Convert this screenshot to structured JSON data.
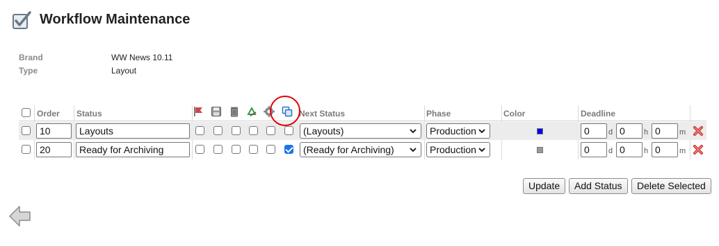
{
  "page": {
    "title": "Workflow Maintenance"
  },
  "meta": {
    "brand_label": "Brand",
    "brand_value": "WW News 10.11",
    "type_label": "Type",
    "type_value": "Layout"
  },
  "table": {
    "headers": {
      "order": "Order",
      "status": "Status",
      "next_status": "Next Status",
      "phase": "Phase",
      "color": "Color",
      "deadline": "Deadline"
    },
    "header_icons": [
      "flag-icon",
      "save-icon",
      "trash-icon",
      "recycle-icon",
      "gear-icon",
      "copy-icon"
    ],
    "units": {
      "d": "d",
      "h": "h",
      "m": "m"
    },
    "rows": [
      {
        "order": "10",
        "status": "Layouts",
        "flags": [
          false,
          false,
          false,
          false,
          false,
          false
        ],
        "next_status": "(Layouts)",
        "phase": "Production",
        "color": "#0000ee",
        "deadline_d": "0",
        "deadline_h": "0",
        "deadline_m": "0"
      },
      {
        "order": "20",
        "status": "Ready for Archiving",
        "flags": [
          false,
          false,
          false,
          false,
          false,
          true
        ],
        "next_status": "(Ready for Archiving)",
        "phase": "Production",
        "color": "#999999",
        "deadline_d": "0",
        "deadline_h": "0",
        "deadline_m": "0"
      }
    ]
  },
  "buttons": {
    "update": "Update",
    "add_status": "Add Status",
    "delete_selected": "Delete Selected"
  },
  "colors": {
    "highlight": "#e00000",
    "delete": "#cc3333"
  }
}
